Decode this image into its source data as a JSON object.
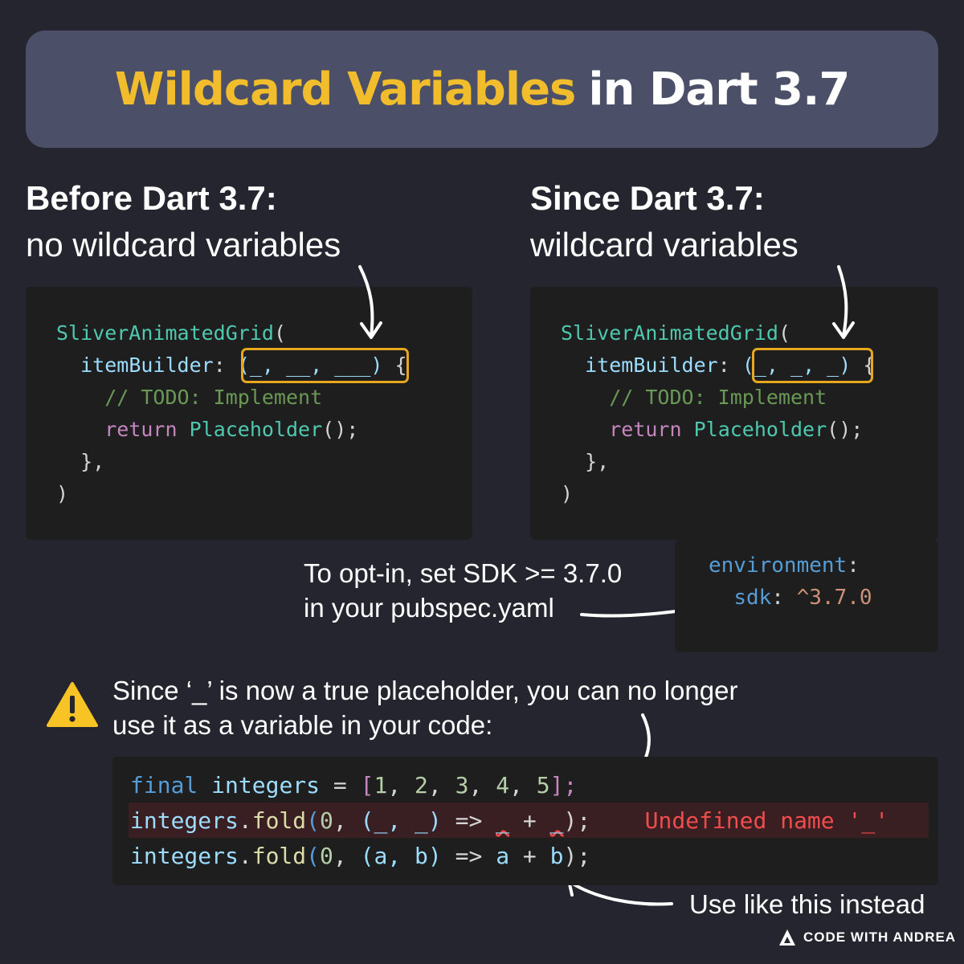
{
  "title": {
    "highlight": "Wildcard Variables",
    "rest": "in Dart 3.7"
  },
  "before": {
    "heading": "Before Dart 3.7:",
    "subheading": "no wildcard variables",
    "code": {
      "line1_fn": "SliverAnimatedGrid",
      "line1_punc": "(",
      "line2_prop": "itemBuilder",
      "line2_colon": ":",
      "line2_params": "(_, __, ___)",
      "line2_brace": "{",
      "line3_comment": "// TODO: Implement",
      "line4_kw": "return",
      "line4_fn": "Placeholder",
      "line4_end": "();",
      "line5": "},",
      "line6": ")"
    }
  },
  "since": {
    "heading": "Since Dart 3.7:",
    "subheading": "wildcard variables",
    "code": {
      "line1_fn": "SliverAnimatedGrid",
      "line1_punc": "(",
      "line2_prop": "itemBuilder",
      "line2_colon": ":",
      "line2_params": "(_, _, _)",
      "line2_brace": "{",
      "line3_comment": "// TODO: Implement",
      "line4_kw": "return",
      "line4_fn": "Placeholder",
      "line4_end": "();",
      "line5": "},",
      "line6": ")"
    }
  },
  "optin": {
    "caption_line1": "To opt-in, set SDK >= 3.7.0",
    "caption_line2": "in your pubspec.yaml",
    "yaml_key1": "environment",
    "yaml_colon": ":",
    "yaml_key2": "sdk",
    "yaml_value": "^3.7.0"
  },
  "warning": {
    "line1": "Since ‘_’ is now a true placeholder, you can no longer",
    "line2": "use it as a variable in your code:",
    "icon": "warning-icon"
  },
  "bottom_code": {
    "l1_kw": "final",
    "l1_name": "integers",
    "l1_eq": "=",
    "l1_open": "[",
    "l1_vals": [
      "1",
      "2",
      "3",
      "4",
      "5"
    ],
    "l1_close": "];",
    "l2_obj": "integers",
    "l2_dot": ".",
    "l2_method": "fold",
    "l2_open": "(",
    "l2_zero": "0",
    "l2_params": "(_, _)",
    "l2_arrow": "=>",
    "l2_a": "_",
    "l2_plus": "+",
    "l2_b": "_",
    "l2_close": ");",
    "l2_error": "Undefined name '_'",
    "l3_params": "(a, b)",
    "l3_a": "a",
    "l3_b": "b"
  },
  "instead_caption": "Use like this instead",
  "brand": {
    "name": "CODE WITH ANDREA",
    "logo": "andrea-logo-icon"
  }
}
